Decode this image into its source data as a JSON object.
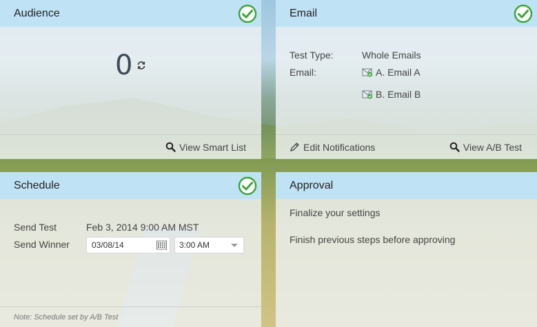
{
  "audience": {
    "title": "Audience",
    "count": "0",
    "view_smart_list": "View Smart List"
  },
  "email": {
    "title": "Email",
    "test_type_label": "Test Type:",
    "test_type_value": "Whole Emails",
    "email_label": "Email:",
    "emails": [
      "A. Email A",
      "B. Email B"
    ],
    "edit_notifications": "Edit Notifications",
    "view_ab_test": "View A/B Test"
  },
  "schedule": {
    "title": "Schedule",
    "send_test_label": "Send Test",
    "send_test_value": "Feb 3, 2014 9:00 AM MST",
    "send_winner_label": "Send Winner",
    "date_value": "03/08/14",
    "time_value": "3:00 AM",
    "note": "Note: Schedule set by A/B Test"
  },
  "approval": {
    "title": "Approval",
    "line1": "Finalize your settings",
    "line2": "Finish previous steps before approving"
  },
  "colors": {
    "header_bg": "#bfe2f5",
    "check_green": "#3aa63a"
  },
  "icons": [
    "check-circle-icon",
    "refresh-icon",
    "magnifier-icon",
    "pencil-icon",
    "email-doc-icon",
    "calendar-icon",
    "dropdown-caret-icon"
  ]
}
